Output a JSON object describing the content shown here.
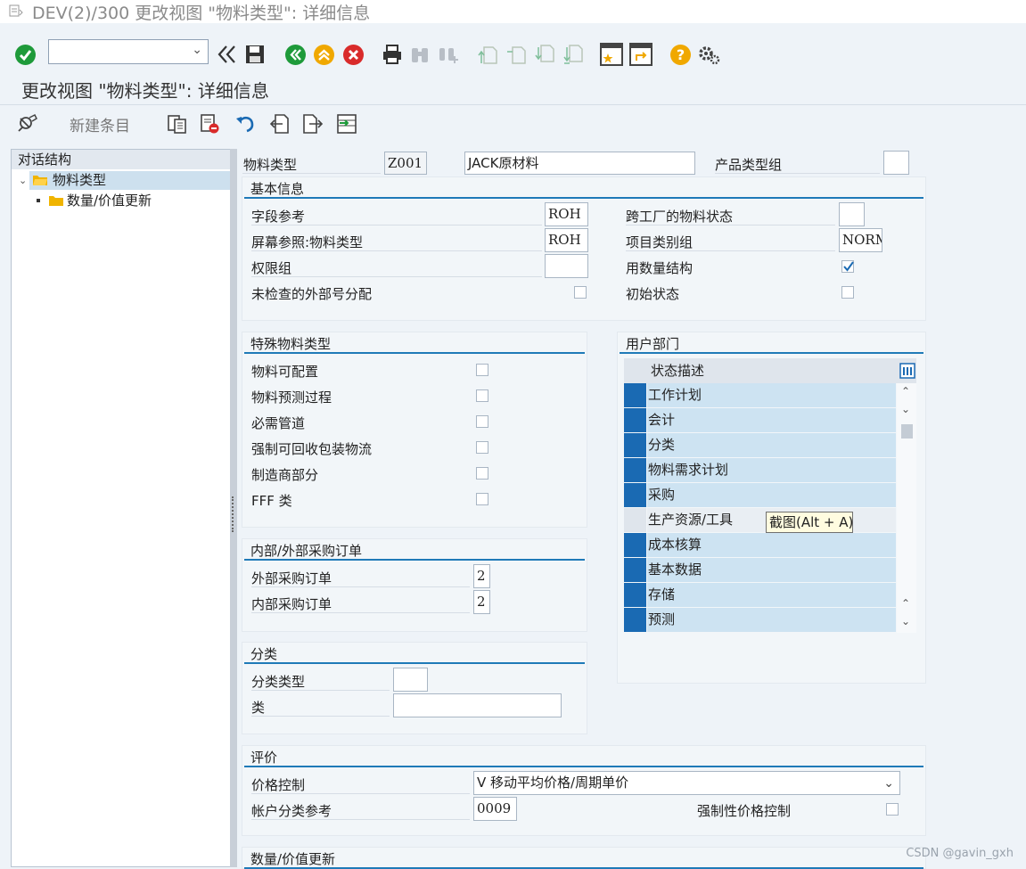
{
  "window": {
    "title": "DEV(2)/300 更改视图 \"物料类型\": 详细信息"
  },
  "toolbar": {
    "command_field_value": ""
  },
  "page": {
    "heading": "更改视图 \"物料类型\": 详细信息"
  },
  "app_toolbar": {
    "new_entries_label": "新建条目"
  },
  "tree": {
    "header": "对话结构",
    "nodes": [
      {
        "label": "物料类型",
        "selected": true
      },
      {
        "label": "数量/价值更新",
        "selected": false
      }
    ]
  },
  "header_fields": {
    "material_type_label": "物料类型",
    "material_type_value": "Z001",
    "material_type_desc": "JACK原材料",
    "product_type_group_label": "产品类型组",
    "product_type_group_value": ""
  },
  "basic": {
    "title": "基本信息",
    "field_ref_label": "字段参考",
    "field_ref_value": "ROH",
    "screen_ref_label": "屏幕参照:物料类型",
    "screen_ref_value": "ROH",
    "auth_group_label": "权限组",
    "auth_group_value": "",
    "ext_num_label": "未检查的外部号分配",
    "ext_num_checked": false,
    "cross_plant_label": "跨工厂的物料状态",
    "cross_plant_value": "",
    "item_cat_label": "项目类别组",
    "item_cat_value": "NORM",
    "qty_struct_label": "用数量结构",
    "qty_struct_checked": true,
    "init_status_label": "初始状态",
    "init_status_checked": false
  },
  "special": {
    "title": "特殊物料类型",
    "items": [
      {
        "label": "物料可配置",
        "checked": false
      },
      {
        "label": "物料预测过程",
        "checked": false
      },
      {
        "label": "必需管道",
        "checked": false
      },
      {
        "label": "强制可回收包装物流",
        "checked": false
      },
      {
        "label": "制造商部分",
        "checked": false
      },
      {
        "label": "FFF 类",
        "checked": false
      }
    ]
  },
  "purchase": {
    "title": "内部/外部采购订单",
    "ext_label": "外部采购订单",
    "ext_value": "2",
    "int_label": "内部采购订单",
    "int_value": "2"
  },
  "classification": {
    "title": "分类",
    "type_label": "分类类型",
    "type_value": "",
    "class_label": "类",
    "class_value": ""
  },
  "user_depts": {
    "title": "用户部门",
    "column_header": "状态描述",
    "rows": [
      {
        "label": "工作计划",
        "selected": true
      },
      {
        "label": "会计",
        "selected": true
      },
      {
        "label": "分类",
        "selected": true
      },
      {
        "label": "物料需求计划",
        "selected": true
      },
      {
        "label": "采购",
        "selected": true
      },
      {
        "label": "生产资源/工具",
        "selected": false
      },
      {
        "label": "成本核算",
        "selected": true
      },
      {
        "label": "基本数据",
        "selected": true
      },
      {
        "label": "存储",
        "selected": true
      },
      {
        "label": "预测",
        "selected": true
      }
    ]
  },
  "tooltip": {
    "text": "截图(Alt + A)"
  },
  "valuation": {
    "title": "评价",
    "price_ctrl_label": "价格控制",
    "price_ctrl_value": "V 移动平均价格/周期单价",
    "acct_cat_label": "帐户分类参考",
    "acct_cat_value": "0009",
    "forced_price_label": "强制性价格控制",
    "forced_price_checked": false
  },
  "qty_value": {
    "title": "数量/价值更新"
  },
  "watermark": "CSDN @gavin_gxh",
  "colors": {
    "accent": "#1f7ab8",
    "selected_row": "#1a6ab3",
    "row_bg": "#cde3f2"
  }
}
